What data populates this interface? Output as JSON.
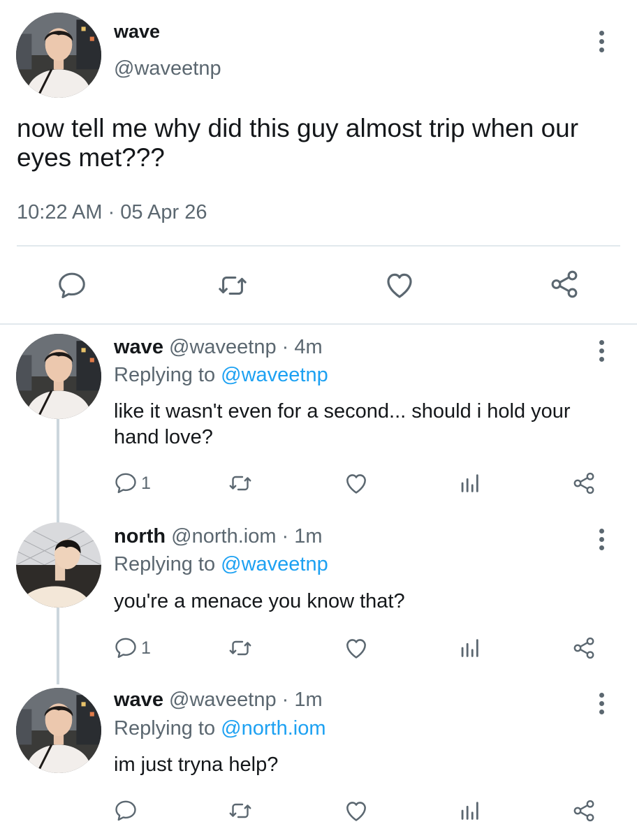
{
  "main_tweet": {
    "name": "wave",
    "handle": "@waveetnp",
    "text": "now tell me why did this guy almost trip when our eyes met???",
    "timestamp": "10:22 AM · 05 Apr 26",
    "actions": [
      "comment-icon",
      "retweet-icon",
      "heart-icon",
      "share-icon"
    ]
  },
  "replies": [
    {
      "name": "wave",
      "handle": "@waveetnp",
      "sep_time": "· 4m",
      "replying_label": "Replying to",
      "replying_to": "@waveetnp",
      "text": "like it wasn't even for a second... should i hold your hand love?",
      "reply_count": "1"
    },
    {
      "name": "north",
      "handle": "@north.iom",
      "sep_time": "· 1m",
      "replying_label": "Replying to",
      "replying_to": "@waveetnp",
      "text": "you're a menace you know that?",
      "reply_count": "1"
    },
    {
      "name": "wave",
      "handle": "@waveetnp",
      "sep_time": "· 1m",
      "replying_label": "Replying to",
      "replying_to": "@north.iom",
      "text": "im just tryna help?",
      "reply_count": ""
    }
  ],
  "colors": {
    "text": "#14171a",
    "secondary": "#5b6770",
    "link": "#1da1f2",
    "divider": "#e1e8ed"
  }
}
